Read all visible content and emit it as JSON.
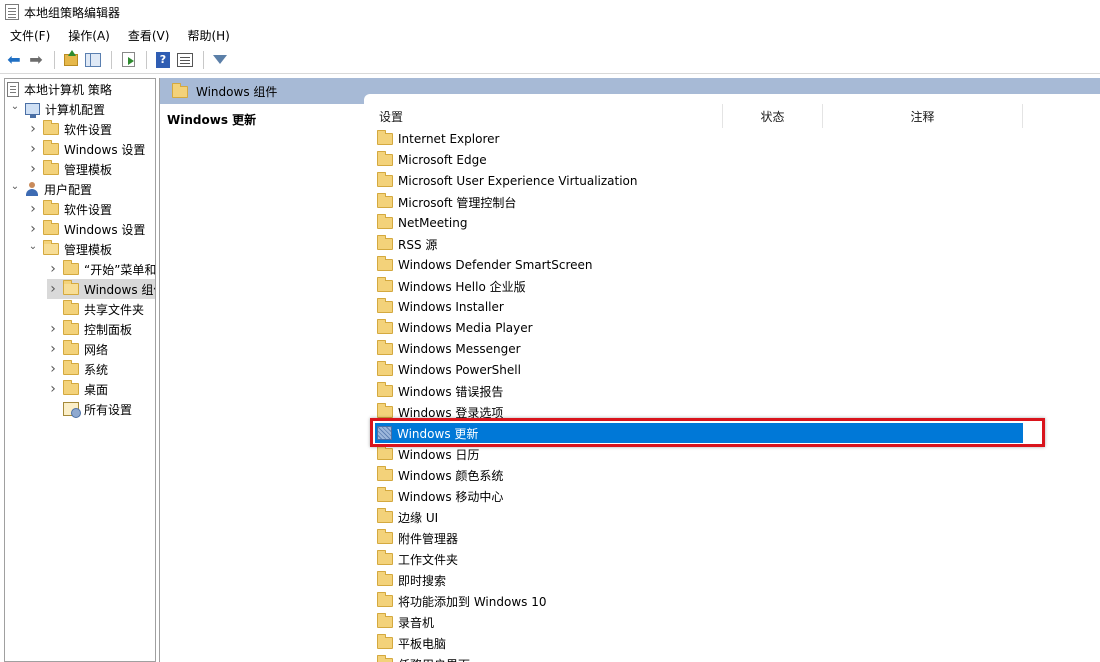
{
  "window": {
    "title": "本地组策略编辑器"
  },
  "menu": [
    {
      "label": "文件(F)"
    },
    {
      "label": "操作(A)"
    },
    {
      "label": "查看(V)"
    },
    {
      "label": "帮助(H)"
    }
  ],
  "toolbar": {
    "icons": [
      "back-arrow-icon",
      "forward-arrow-icon",
      "up-folder-icon",
      "show-hide-tree-icon",
      "export-list-icon",
      "help-icon",
      "properties-icon",
      "filter-icon"
    ]
  },
  "tree": [
    {
      "label": "本地计算机 策略",
      "icon": "policy-document-icon",
      "indent": 0,
      "chevron": ""
    },
    {
      "label": "计算机配置",
      "icon": "computer-icon",
      "indent": 1,
      "chevron": "expanded"
    },
    {
      "label": "软件设置",
      "icon": "folder-icon",
      "indent": 2,
      "chevron": "collapsed"
    },
    {
      "label": "Windows 设置",
      "icon": "folder-icon",
      "indent": 2,
      "chevron": "collapsed"
    },
    {
      "label": "管理模板",
      "icon": "folder-icon",
      "indent": 2,
      "chevron": "collapsed"
    },
    {
      "label": "用户配置",
      "icon": "user-icon",
      "indent": 1,
      "chevron": "expanded"
    },
    {
      "label": "软件设置",
      "icon": "folder-icon",
      "indent": 2,
      "chevron": "collapsed"
    },
    {
      "label": "Windows 设置",
      "icon": "folder-icon",
      "indent": 2,
      "chevron": "collapsed"
    },
    {
      "label": "管理模板",
      "icon": "folder-open-icon",
      "indent": 2,
      "chevron": "expanded"
    },
    {
      "label": "“开始”菜单和",
      "icon": "folder-icon",
      "indent": 3,
      "chevron": "collapsed"
    },
    {
      "label": "Windows 组件",
      "icon": "folder-open-icon",
      "indent": 3,
      "chevron": "collapsed",
      "selected": true
    },
    {
      "label": "共享文件夹",
      "icon": "folder-icon",
      "indent": 3,
      "chevron": ""
    },
    {
      "label": "控制面板",
      "icon": "folder-icon",
      "indent": 3,
      "chevron": "collapsed"
    },
    {
      "label": "网络",
      "icon": "folder-icon",
      "indent": 3,
      "chevron": "collapsed"
    },
    {
      "label": "系统",
      "icon": "folder-icon",
      "indent": 3,
      "chevron": "collapsed"
    },
    {
      "label": "桌面",
      "icon": "folder-icon",
      "indent": 3,
      "chevron": "collapsed"
    },
    {
      "label": "所有设置",
      "icon": "all-settings-icon",
      "indent": 3,
      "chevron": ""
    }
  ],
  "right_pane": {
    "header_title": "Windows 组件",
    "description_title": "Windows 更新",
    "columns": [
      "设置",
      "状态",
      "注释"
    ],
    "items": [
      {
        "label": "Internet Explorer"
      },
      {
        "label": "Microsoft Edge"
      },
      {
        "label": "Microsoft User Experience Virtualization"
      },
      {
        "label": "Microsoft 管理控制台"
      },
      {
        "label": "NetMeeting"
      },
      {
        "label": "RSS 源"
      },
      {
        "label": "Windows Defender SmartScreen"
      },
      {
        "label": "Windows Hello 企业版"
      },
      {
        "label": "Windows Installer"
      },
      {
        "label": "Windows Media Player"
      },
      {
        "label": "Windows Messenger"
      },
      {
        "label": "Windows PowerShell"
      },
      {
        "label": "Windows 错误报告"
      },
      {
        "label": "Windows 登录选项"
      },
      {
        "label": "Windows 更新",
        "selected": true
      },
      {
        "label": "Windows 日历"
      },
      {
        "label": "Windows 颜色系统"
      },
      {
        "label": "Windows 移动中心"
      },
      {
        "label": "边缘 UI"
      },
      {
        "label": "附件管理器"
      },
      {
        "label": "工作文件夹"
      },
      {
        "label": "即时搜索"
      },
      {
        "label": "将功能添加到 Windows 10"
      },
      {
        "label": "录音机"
      },
      {
        "label": "平板电脑"
      },
      {
        "label": "任務用户界面"
      }
    ]
  },
  "colors": {
    "selection": "#0078d7",
    "header_band": "#a7bad6",
    "highlight_border": "#d9141c"
  }
}
